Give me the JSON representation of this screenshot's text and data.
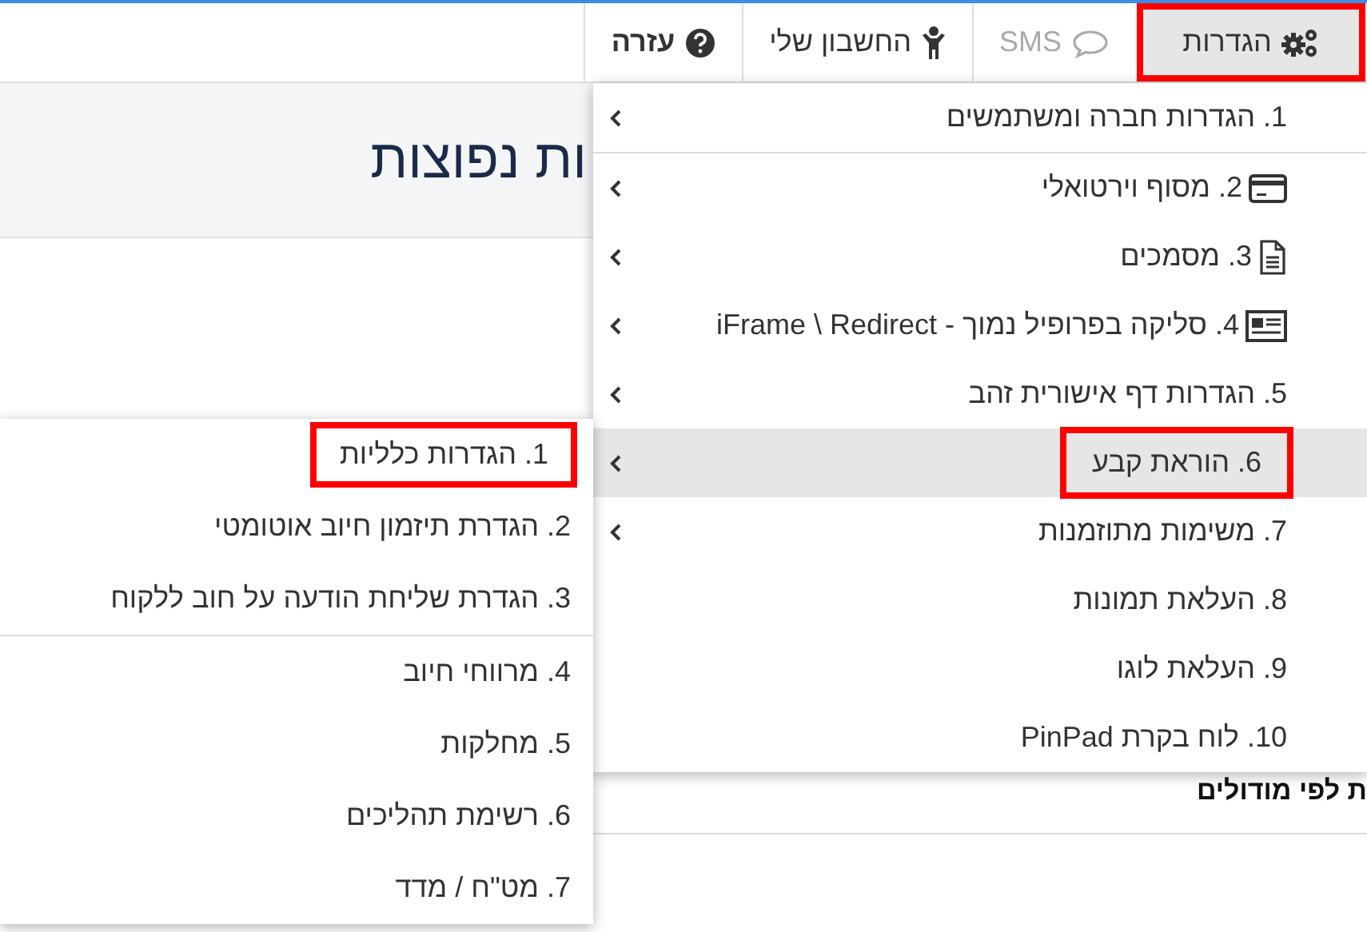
{
  "nav": {
    "items": [
      {
        "label": "הגדרות",
        "kind": "gears",
        "selected": true,
        "disabled": false,
        "bold": false,
        "highlighted": true
      },
      {
        "label": "SMS",
        "kind": "chat",
        "selected": false,
        "disabled": true,
        "bold": false,
        "highlighted": false
      },
      {
        "label": "החשבון שלי",
        "kind": "person",
        "selected": false,
        "disabled": false,
        "bold": false,
        "highlighted": false
      },
      {
        "label": "עזרה",
        "kind": "help",
        "selected": false,
        "disabled": false,
        "bold": true,
        "highlighted": false
      }
    ]
  },
  "page": {
    "title": "ות נפוצות",
    "section_heading": "ת לפי מודולים"
  },
  "menu": {
    "items": [
      {
        "label": "1. הגדרות חברה ומשתמשים",
        "has_submenu": true,
        "selected": false,
        "highlighted": false,
        "divider_after": true
      },
      {
        "label": "2. מסוף וירטואלי",
        "kind": "card",
        "has_submenu": true,
        "selected": false,
        "highlighted": false,
        "divider_after": false
      },
      {
        "label": "3. מסמכים",
        "kind": "document",
        "has_submenu": true,
        "selected": false,
        "highlighted": false,
        "divider_after": false
      },
      {
        "label": "4. סליקה בפרופיל נמוך - iFrame \\ Redirect",
        "kind": "newspaper",
        "has_submenu": true,
        "selected": false,
        "highlighted": false,
        "divider_after": false
      },
      {
        "label": "5. הגדרות דף אישורית זהב",
        "has_submenu": true,
        "selected": false,
        "highlighted": false,
        "divider_after": false
      },
      {
        "label": "6. הוראת קבע",
        "has_submenu": true,
        "selected": true,
        "highlighted": true,
        "divider_after": false
      },
      {
        "label": "7. משימות מתוזמנות",
        "has_submenu": true,
        "selected": false,
        "highlighted": false,
        "divider_after": false
      },
      {
        "label": "8. העלאת תמונות",
        "has_submenu": false,
        "selected": false,
        "highlighted": false,
        "divider_after": false
      },
      {
        "label": "9. העלאת לוגו",
        "has_submenu": false,
        "selected": false,
        "highlighted": false,
        "divider_after": false
      },
      {
        "label": "10. לוח בקרת PinPad",
        "has_submenu": false,
        "selected": false,
        "highlighted": false,
        "divider_after": false
      }
    ]
  },
  "submenu": {
    "items": [
      {
        "label": "1. הגדרות כלליות",
        "highlighted": true,
        "divider_after": false
      },
      {
        "label": "2. הגדרת תיזמון חיוב אוטומטי",
        "highlighted": false,
        "divider_after": false
      },
      {
        "label": "3. הגדרת שליחת הודעה על חוב ללקוח",
        "highlighted": false,
        "divider_after": true
      },
      {
        "label": "4. מרווחי חיוב",
        "highlighted": false,
        "divider_after": false
      },
      {
        "label": "5. מחלקות",
        "highlighted": false,
        "divider_after": false
      },
      {
        "label": "6. רשימת תהליכים",
        "highlighted": false,
        "divider_after": false
      },
      {
        "label": "7. מט\"ח / מדד",
        "highlighted": false,
        "divider_after": false
      }
    ]
  }
}
